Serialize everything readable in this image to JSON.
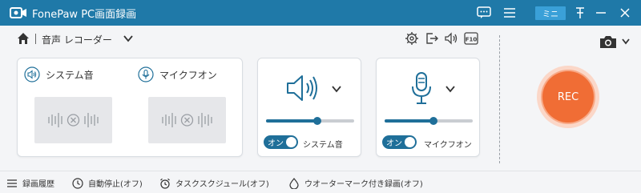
{
  "window": {
    "title": "FonePaw PC画面録画",
    "mini_label": "ミニ"
  },
  "toolbar": {
    "mode_label": "音声 レコーダー"
  },
  "system_audio": {
    "label": "システム音",
    "toggle_label": "オン",
    "caption": "システム音",
    "volume": 0.58
  },
  "microphone": {
    "label": "マイクフオン",
    "toggle_label": "オン",
    "caption": "マイクフオン",
    "volume": 0.55
  },
  "rec": {
    "label": "REC"
  },
  "bottom_bar": {
    "history": "録画履歴",
    "auto_stop": "自動停止(オフ)",
    "task_schedule": "タスクスクジュール(オフ)",
    "watermark": "ウオーターマーク付き録画(オフ)"
  },
  "colors": {
    "titlebar": "#1f79a8",
    "accent": "#1f6f99",
    "rec": "#f06d35"
  }
}
